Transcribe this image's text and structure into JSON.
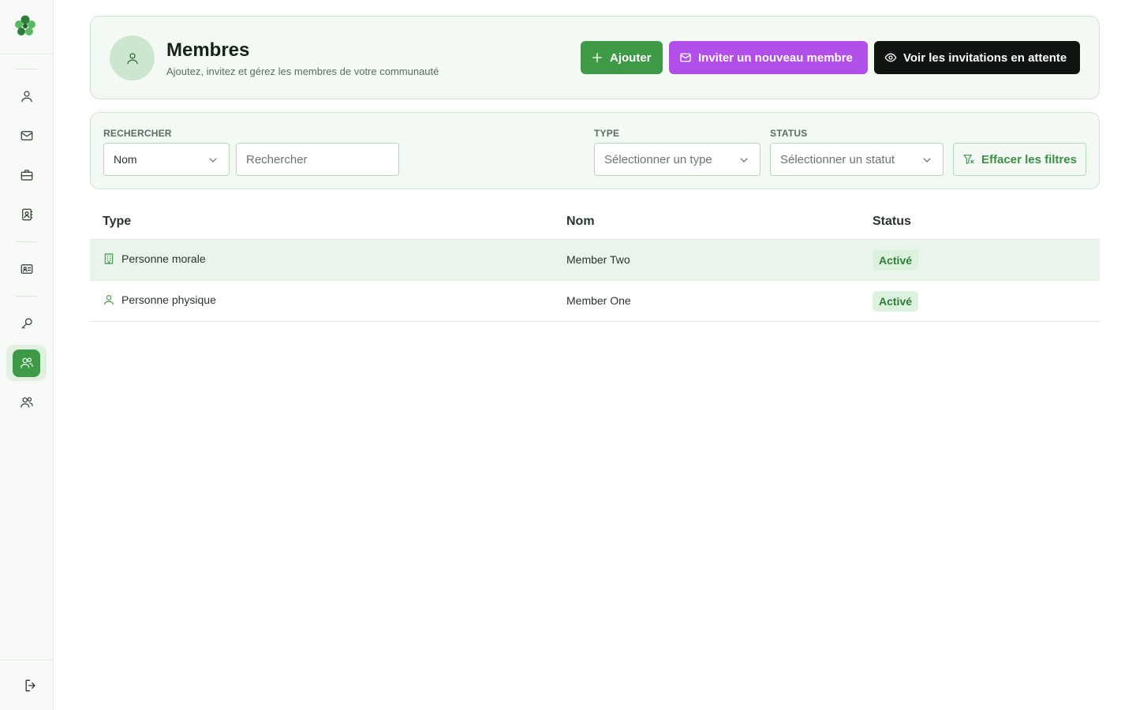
{
  "sidebar": {
    "logo_icon": "clover-logo-icon",
    "items": [
      {
        "icon": "user-icon",
        "name": "nav-profile"
      },
      {
        "icon": "mail-icon",
        "name": "nav-messages"
      },
      {
        "icon": "briefcase-icon",
        "name": "nav-jobs"
      },
      {
        "icon": "contact-book-icon",
        "name": "nav-directory"
      },
      {
        "icon": "id-card-icon",
        "name": "nav-card"
      },
      {
        "icon": "key-icon",
        "name": "nav-keys"
      },
      {
        "icon": "users-icon",
        "name": "nav-members",
        "active": true
      },
      {
        "icon": "users-icon",
        "name": "nav-groups"
      }
    ],
    "logout_icon": "logout-icon"
  },
  "header": {
    "title": "Membres",
    "subtitle": "Ajoutez, invitez et gérez les membres de votre communauté",
    "add_label": "Ajouter",
    "invite_label": "Inviter un nouveau membre",
    "pending_label": "Voir les invitations en attente"
  },
  "filters": {
    "search_label": "RECHERCHER",
    "search_field_value": "Nom",
    "search_placeholder": "Rechercher",
    "type_label": "TYPE",
    "type_placeholder": "Sélectionner un type",
    "status_label": "STATUS",
    "status_placeholder": "Sélectionner un statut",
    "clear_label": "Effacer les filtres"
  },
  "table": {
    "columns": [
      "Type",
      "Nom",
      "Status"
    ],
    "rows": [
      {
        "type": "Personne morale",
        "type_icon": "building-icon",
        "name": "Member Two",
        "status": "Activé"
      },
      {
        "type": "Personne physique",
        "type_icon": "user-icon",
        "name": "Member One",
        "status": "Activé"
      }
    ]
  },
  "colors": {
    "primary_green": "#3f9a47",
    "invite_purple": "#b14fe8",
    "dark_button": "#0f1411",
    "card_bg": "#f3faf3"
  }
}
